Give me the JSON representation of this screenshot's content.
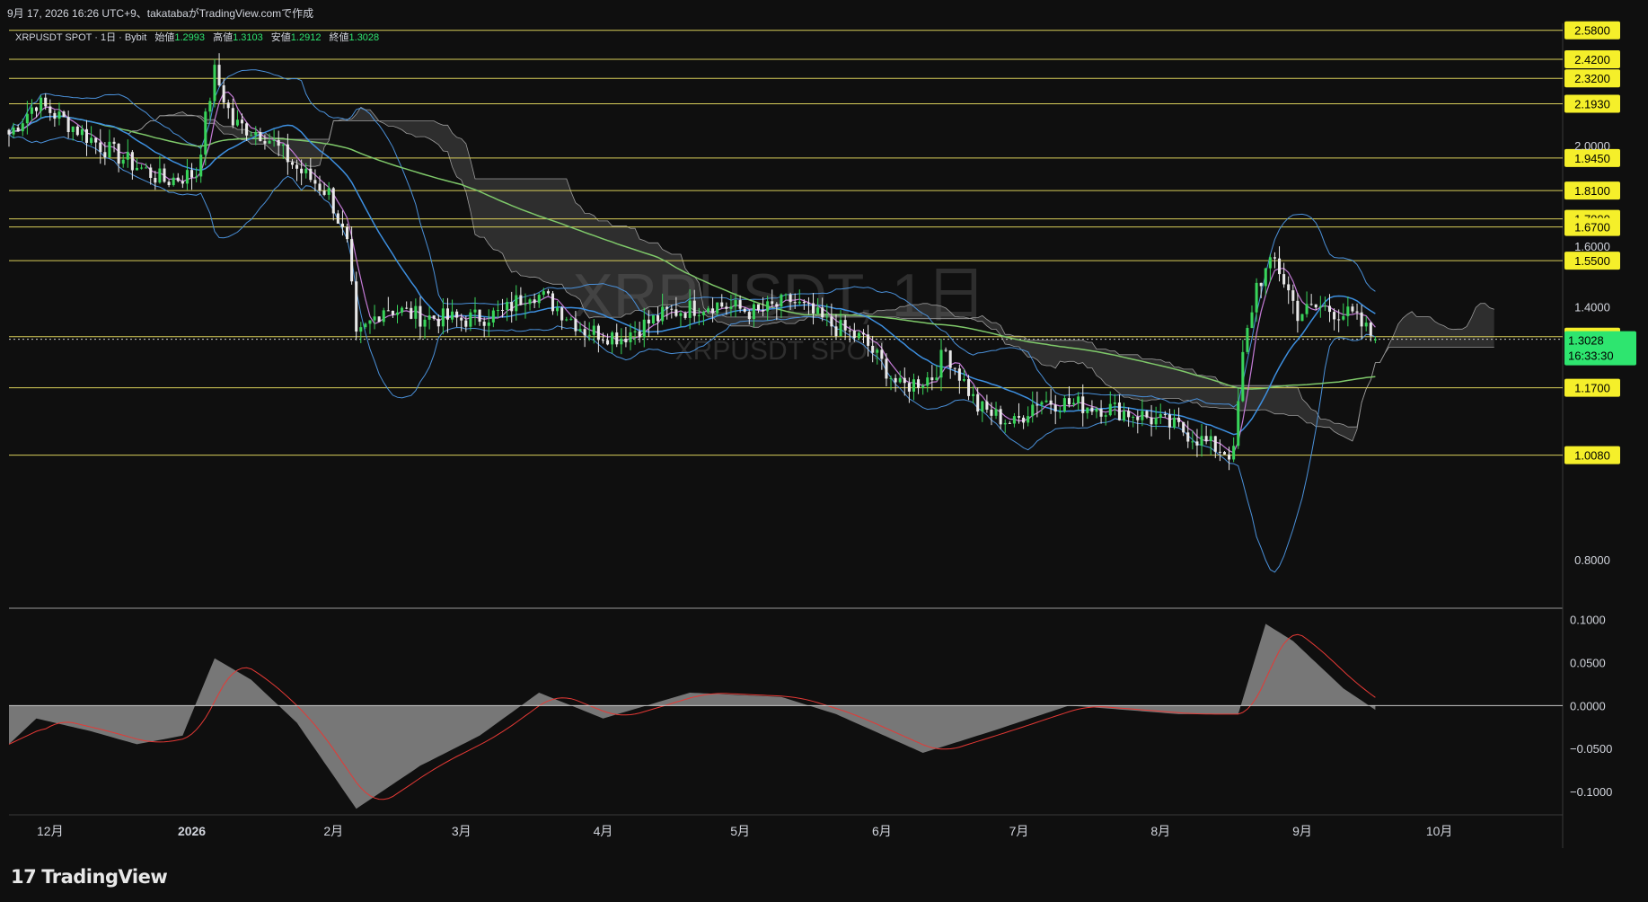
{
  "header": {
    "caption": "9月 17, 2026 16:26 UTC+9、takatabaがTradingView.comで作成"
  },
  "legend": {
    "symbol": "XRPUSDT SPOT · 1日 · Bybit",
    "open_label": "始値",
    "open": "1.2993",
    "high_label": "高値",
    "high": "1.3103",
    "low_label": "安値",
    "low": "1.2912",
    "close_label": "終値",
    "close": "1.3028"
  },
  "watermark": {
    "main": "XRPUSDT, 1日",
    "sub": "XRPUSDT SPOT"
  },
  "price_axis": {
    "ticks": [
      "2.0000",
      "1.6000",
      "1.4000",
      "0.8000"
    ],
    "levels": [
      "2.5800",
      "2.4200",
      "2.3200",
      "2.1930",
      "1.9450",
      "1.8100",
      "1.7000",
      "1.6700",
      "1.5500",
      "1.3100",
      "1.1700",
      "1.0080"
    ],
    "current_price": "1.3028",
    "countdown": "16:33:30"
  },
  "macd_axis": {
    "ticks": [
      "0.1000",
      "0.0500",
      "0.0000",
      "−0.0500",
      "−0.1000"
    ]
  },
  "time_axis": {
    "labels": [
      "12月",
      "2026",
      "2月",
      "3月",
      "4月",
      "5月",
      "6月",
      "7月",
      "8月",
      "9月",
      "10月"
    ]
  },
  "footer": {
    "brand": "TradingView"
  },
  "colors": {
    "background": "#0f0f0f",
    "level_line": "#d9cf5a",
    "level_tag": "#f5ef2a",
    "price_tag": "#2ee56f",
    "bollinger": "#4a90d9",
    "ma_short": "#c47bd6",
    "ma_mid": "#3d8fe0",
    "ma_long": "#7fc96a",
    "candle_up": "#38d45a",
    "candle_down": "#e8e8e8",
    "cloud": "#6b6b6b",
    "macd_hist": "#8a8a8a",
    "macd_signal": "#e53935"
  },
  "chart_data": {
    "type": "candlestick",
    "symbol": "XRPUSDT SPOT",
    "interval": "1日",
    "exchange": "Bybit",
    "ohlc_last": {
      "open": 1.2993,
      "high": 1.3103,
      "low": 1.2912,
      "close": 1.3028
    },
    "horizontal_levels": [
      2.58,
      2.42,
      2.32,
      2.193,
      1.945,
      1.81,
      1.7,
      1.67,
      1.55,
      1.31,
      1.17,
      1.008
    ],
    "price_anchors": [
      [
        "2025-11-22",
        2.05
      ],
      [
        "2025-11-28",
        2.2
      ],
      [
        "2025-12-05",
        2.1
      ],
      [
        "2025-12-12",
        2.0
      ],
      [
        "2025-12-19",
        1.92
      ],
      [
        "2025-12-26",
        1.85
      ],
      [
        "2026-01-02",
        1.88
      ],
      [
        "2026-01-06",
        2.35
      ],
      [
        "2026-01-10",
        2.1
      ],
      [
        "2026-01-17",
        2.05
      ],
      [
        "2026-01-24",
        1.9
      ],
      [
        "2026-01-31",
        1.8
      ],
      [
        "2026-02-04",
        1.6
      ],
      [
        "2026-02-06",
        1.3
      ],
      [
        "2026-02-12",
        1.4
      ],
      [
        "2026-02-20",
        1.37
      ],
      [
        "2026-03-01",
        1.36
      ],
      [
        "2026-03-10",
        1.38
      ],
      [
        "2026-03-16",
        1.45
      ],
      [
        "2026-03-20",
        1.42
      ],
      [
        "2026-03-28",
        1.33
      ],
      [
        "2026-04-05",
        1.31
      ],
      [
        "2026-04-15",
        1.38
      ],
      [
        "2026-04-25",
        1.41
      ],
      [
        "2026-05-05",
        1.38
      ],
      [
        "2026-05-12",
        1.42
      ],
      [
        "2026-05-20",
        1.35
      ],
      [
        "2026-05-28",
        1.3
      ],
      [
        "2026-06-05",
        1.17
      ],
      [
        "2026-06-12",
        1.2
      ],
      [
        "2026-06-15",
        1.27
      ],
      [
        "2026-06-22",
        1.12
      ],
      [
        "2026-06-30",
        1.08
      ],
      [
        "2026-07-05",
        1.14
      ],
      [
        "2026-07-12",
        1.13
      ],
      [
        "2026-07-20",
        1.12
      ],
      [
        "2026-07-28",
        1.1
      ],
      [
        "2026-08-05",
        1.07
      ],
      [
        "2026-08-12",
        1.03
      ],
      [
        "2026-08-17",
        1.01
      ],
      [
        "2026-08-19",
        1.25
      ],
      [
        "2026-08-22",
        1.47
      ],
      [
        "2026-08-26",
        1.55
      ],
      [
        "2026-08-31",
        1.38
      ],
      [
        "2026-09-05",
        1.4
      ],
      [
        "2026-09-12",
        1.37
      ],
      [
        "2026-09-17",
        1.3028
      ]
    ],
    "macd_anchors": [
      [
        "2025-11-22",
        -0.045
      ],
      [
        "2025-11-28",
        -0.015
      ],
      [
        "2025-12-10",
        -0.03
      ],
      [
        "2025-12-20",
        -0.045
      ],
      [
        "2025-12-30",
        -0.035
      ],
      [
        "2026-01-06",
        0.055
      ],
      [
        "2026-01-14",
        0.03
      ],
      [
        "2026-01-24",
        -0.02
      ],
      [
        "2026-02-06",
        -0.12
      ],
      [
        "2026-02-20",
        -0.07
      ],
      [
        "2026-03-05",
        -0.035
      ],
      [
        "2026-03-18",
        0.015
      ],
      [
        "2026-04-01",
        -0.015
      ],
      [
        "2026-04-20",
        0.015
      ],
      [
        "2026-05-10",
        0.01
      ],
      [
        "2026-05-22",
        -0.01
      ],
      [
        "2026-06-10",
        -0.055
      ],
      [
        "2026-06-25",
        -0.03
      ],
      [
        "2026-07-12",
        0.0
      ],
      [
        "2026-08-05",
        -0.01
      ],
      [
        "2026-08-18",
        -0.01
      ],
      [
        "2026-08-24",
        0.095
      ],
      [
        "2026-08-30",
        0.075
      ],
      [
        "2026-09-10",
        0.02
      ],
      [
        "2026-09-17",
        -0.005
      ]
    ],
    "y_range": [
      0.72,
      2.62
    ],
    "macd_range": [
      -0.125,
      0.11
    ],
    "x_range": [
      "2025-11-22",
      "2026-10-28"
    ]
  }
}
